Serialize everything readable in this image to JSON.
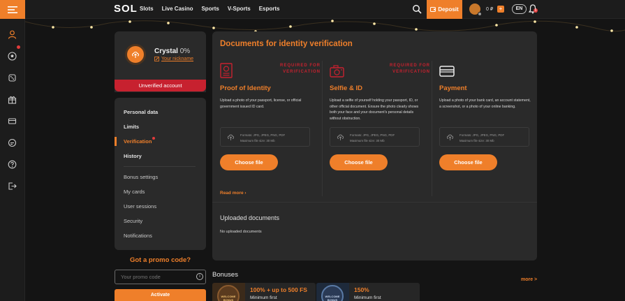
{
  "header": {
    "logo": "SOL",
    "nav": [
      "Slots",
      "Live Casino",
      "Sports",
      "V-Sports",
      "Esports"
    ],
    "deposit_label": "Deposit",
    "balance": "0 ₽",
    "plus": "+",
    "lang": "EN",
    "notifications_count": "5"
  },
  "rail": {
    "icons": [
      "profile-icon",
      "sports-ball-icon",
      "dice-icon",
      "gift-icon",
      "ticket-icon",
      "chat-icon",
      "help-icon",
      "logout-icon"
    ]
  },
  "profile": {
    "name": "Crystal",
    "percent": "0%",
    "nickname_link": "Your nickname",
    "status": "Unverified account"
  },
  "side_menu": {
    "primary": [
      "Personal data",
      "Limits",
      "Verification",
      "History"
    ],
    "secondary": [
      "Bonus settings",
      "My cards",
      "User sessions",
      "Security",
      "Notifications"
    ],
    "active": "Verification"
  },
  "promo": {
    "title": "Got a promo code?",
    "placeholder": "Your promo code",
    "info_icon": "i",
    "button": "Activate"
  },
  "verification": {
    "title": "Documents for identity verification",
    "documents": [
      {
        "icon": "passport-icon",
        "required": "REQUIRED FOR VERIFICATION",
        "title": "Proof of Identity",
        "description": "Upload a photo of your passport, license, or official government issued ID card.",
        "formats": "Formats: JPG, JPEG, PNG, PDF",
        "max_size": "Maximum file size: 30 Mb",
        "button": "Choose file"
      },
      {
        "icon": "camera-icon",
        "required": "REQUIRED FOR VERIFICATION",
        "title": "Selfie & ID",
        "description": "Upload a selfie of yourself holding your passport, ID, or other official document. Ensure the photo clearly shows both your face and your document's personal details without obstruction.",
        "formats": "Formats: JPG, JPEG, PNG, PDF",
        "max_size": "Maximum file size: 30 Mb",
        "button": "Choose file"
      },
      {
        "icon": "card-icon",
        "required": "",
        "title": "Payment",
        "description": "Upload a photo of your bank card, an account statement, a screenshot, or a photo of your online banking.",
        "formats": "Formats: JPG, JPEG, PNG, PDF",
        "max_size": "Maximum file size: 30 Mb",
        "button": "Choose file"
      }
    ],
    "read_more": "Read more",
    "uploaded_title": "Uploaded documents",
    "uploaded_empty": "No uploaded documents"
  },
  "bonuses": {
    "title": "Bonuses",
    "more": "more >",
    "cards": [
      {
        "badge": "WELCOME BONUS",
        "amount": "100% + up to 500 FS",
        "sub": "Minimum first"
      },
      {
        "badge": "WELCOME BONUS",
        "amount": "150%",
        "sub": "Minimum first"
      }
    ]
  },
  "colors": {
    "accent": "#ef7f2a",
    "danger": "#c7212f",
    "panel": "#2a2a2a",
    "background": "#141414"
  }
}
